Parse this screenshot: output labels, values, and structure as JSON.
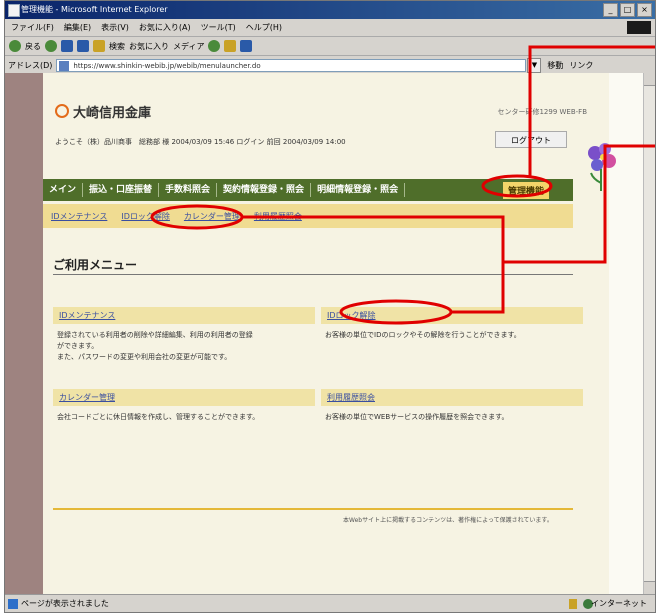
{
  "browser": {
    "title": "管理機能 - Microsoft Internet Explorer",
    "menu": [
      "ファイル(F)",
      "編集(E)",
      "表示(V)",
      "お気に入り(A)",
      "ツール(T)",
      "ヘルプ(H)"
    ],
    "toolbar": {
      "back": "戻る",
      "search": "検索",
      "favorites": "お気に入り",
      "media": "メディア"
    },
    "address_label": "アドレス(D)",
    "url": "https://www.shinkin-webib.jp/webib/menulauncher.do",
    "go": "移動",
    "links": "リンク"
  },
  "header": {
    "bank_name": "大崎信用金庫",
    "center_info": "センター研修1299 WEB-FB",
    "welcome": "ようこそ（株）品川商事　総務部 様 2004/03/09 15:46 ログイン 前回 2004/03/09 14:00",
    "logout": "ログアウト"
  },
  "nav": {
    "items": [
      "メイン",
      "振込・口座振替",
      "手数料照会",
      "契約情報登録・照会",
      "明細情報登録・照会"
    ],
    "admin": "管理機能"
  },
  "subnav": {
    "items": [
      "IDメンテナンス",
      "IDロック解除",
      "カレンダー管理",
      "利用履歴照会"
    ]
  },
  "menu": {
    "title": "ご利用メニュー",
    "cards": [
      {
        "title": "IDメンテナンス",
        "desc": [
          "登録されている利用者の削除や詳細編集、利用の利用者の登録",
          "ができます。",
          "また、パスワードの変更や利用会社の変更が可能です。"
        ]
      },
      {
        "title": "IDロック解除",
        "desc": [
          "お客様の単位でIDのロックやその解除を行うことができます。"
        ]
      },
      {
        "title": "カレンダー管理",
        "desc": [
          "会社コードごとに休日情報を作成し、管理することができます。"
        ]
      },
      {
        "title": "利用履歴照会",
        "desc": [
          "お客様の単位でWEBサービスの操作履歴を照会できます。"
        ]
      }
    ],
    "footer_note": "本Webサイト上に掲載するコンテンツは、著作権によって保護されています。"
  },
  "status": {
    "text": "ページが表示されました",
    "zone": "インターネット"
  },
  "colors": {
    "annotation": "#e00000",
    "nav_bg": "#4f6e2a",
    "subnav_bg": "#f0dc92",
    "admin_bg": "#f3d56a"
  }
}
